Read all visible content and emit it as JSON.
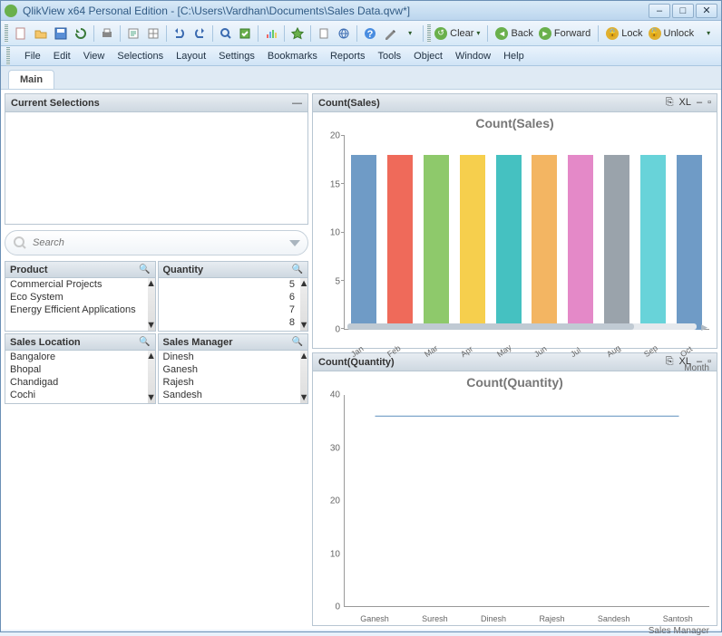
{
  "window": {
    "title": "QlikView x64 Personal Edition - [C:\\Users\\Vardhan\\Documents\\Sales Data.qvw*]"
  },
  "toolbar": {
    "clear": "Clear",
    "back": "Back",
    "forward": "Forward",
    "lock": "Lock",
    "unlock": "Unlock"
  },
  "menu": [
    "File",
    "Edit",
    "View",
    "Selections",
    "Layout",
    "Settings",
    "Bookmarks",
    "Reports",
    "Tools",
    "Object",
    "Window",
    "Help"
  ],
  "tab": {
    "main": "Main"
  },
  "current_selections": {
    "title": "Current Selections"
  },
  "search": {
    "placeholder": "Search"
  },
  "listboxes": {
    "product": {
      "title": "Product",
      "items": [
        "Commercial Projects",
        "Eco System",
        "Energy Efficient Applications"
      ]
    },
    "quantity": {
      "title": "Quantity",
      "items": [
        "5",
        "6",
        "7",
        "8"
      ]
    },
    "location": {
      "title": "Sales Location",
      "items": [
        "Bangalore",
        "Bhopal",
        "Chandigad",
        "Cochi"
      ]
    },
    "manager": {
      "title": "Sales Manager",
      "items": [
        "Dinesh",
        "Ganesh",
        "Rajesh",
        "Sandesh"
      ]
    }
  },
  "chart_data": [
    {
      "type": "bar",
      "panel_title": "Count(Sales)",
      "title": "Count(Sales)",
      "xlabel": "Month",
      "ylabel": "",
      "ylim": [
        0,
        20
      ],
      "yticks": [
        0,
        5,
        10,
        15,
        20
      ],
      "categories": [
        "Jan",
        "Feb",
        "Mar",
        "Apr",
        "May",
        "Jun",
        "Jul",
        "Aug",
        "Sep",
        "Oct"
      ],
      "values": [
        18,
        18,
        18,
        18,
        18,
        18,
        18,
        18,
        18,
        18
      ],
      "colors": [
        "#6f9bc6",
        "#ef6a5a",
        "#8ec96b",
        "#f6cf4d",
        "#45c1c1",
        "#f3b562",
        "#e489c8",
        "#9aa3ab",
        "#68d3d9",
        "#6f9bc6"
      ]
    },
    {
      "type": "line",
      "panel_title": "Count(Quantity)",
      "title": "Count(Quantity)",
      "xlabel": "Sales Manager",
      "ylabel": "",
      "ylim": [
        0,
        40
      ],
      "yticks": [
        0,
        10,
        20,
        30,
        40
      ],
      "categories": [
        "Ganesh",
        "Suresh",
        "Dinesh",
        "Rajesh",
        "Sandesh",
        "Santosh"
      ],
      "values": [
        36,
        36,
        36,
        36,
        36,
        36
      ],
      "series": [
        {
          "name": "Count(Quantity)",
          "values": [
            36,
            36,
            36,
            36,
            36,
            36
          ],
          "color": "#6f9bc6"
        }
      ]
    }
  ],
  "panel_controls": {
    "cycle": "⎘",
    "xl": "XL",
    "min": "–",
    "close": "▫"
  }
}
